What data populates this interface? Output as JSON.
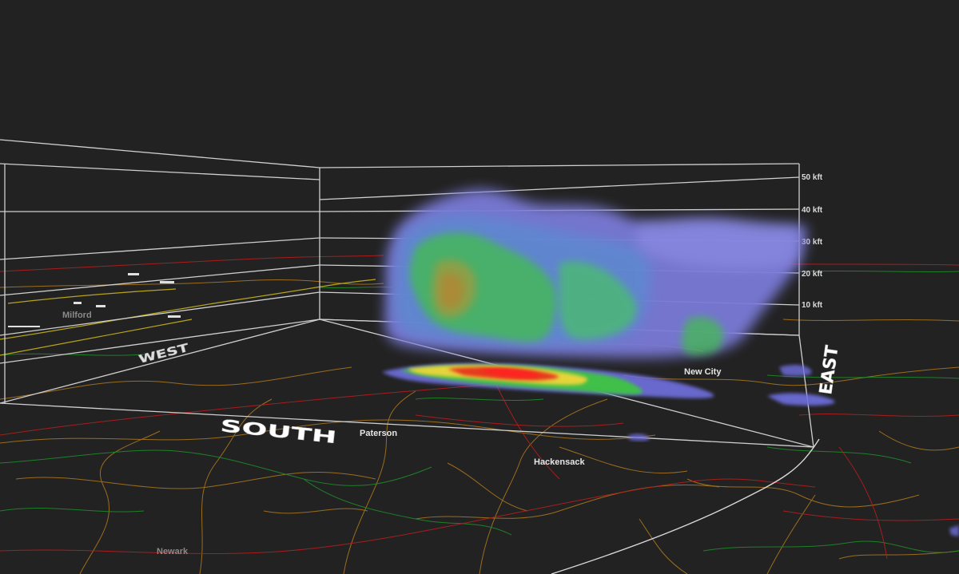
{
  "view": {
    "background": "#222222",
    "box_color": "#cfcfcf",
    "county_color": "#b07a1e",
    "road_color": "#c02020",
    "state_color": "#1f8a2a",
    "highway_color": "#c9b21c"
  },
  "altitude_labels": [
    "50 kft",
    "40 kft",
    "30 kft",
    "20 kft",
    "10 kft"
  ],
  "direction_labels": {
    "south": "SOUTH",
    "east": "EAST",
    "west": "WEST"
  },
  "cities": [
    {
      "name": "New City"
    },
    {
      "name": "Paterson"
    },
    {
      "name": "Hackensack"
    },
    {
      "name": "Newark"
    },
    {
      "name": "Milford"
    }
  ],
  "reflectivity_colors": [
    "#6f6fe0",
    "#3fbf4a",
    "#e6d43a",
    "#e63a1e",
    "#ff2020"
  ]
}
